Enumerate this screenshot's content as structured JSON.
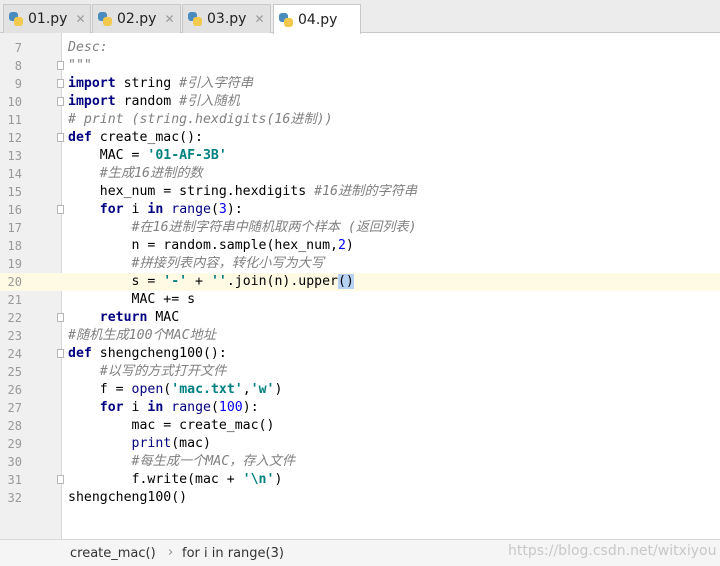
{
  "tabs": [
    {
      "label": "01.py",
      "active": false
    },
    {
      "label": "02.py",
      "active": false
    },
    {
      "label": "03.py",
      "active": false
    },
    {
      "label": "04.py",
      "active": true
    }
  ],
  "lines": [
    {
      "n": "7",
      "t": "Desc:"
    },
    {
      "n": "8",
      "t": "\"\"\""
    },
    {
      "n": "9",
      "t": "import string #引入字符串"
    },
    {
      "n": "10",
      "t": "import random #引入随机"
    },
    {
      "n": "11",
      "t": "# print (string.hexdigits(16进制))"
    },
    {
      "n": "12",
      "t": "def create_mac():"
    },
    {
      "n": "13",
      "t": "    MAC = '01-AF-3B'"
    },
    {
      "n": "14",
      "t": "    #生成16进制的数"
    },
    {
      "n": "15",
      "t": "    hex_num = string.hexdigits #16进制的字符串"
    },
    {
      "n": "16",
      "t": "    for i in range(3):"
    },
    {
      "n": "17",
      "t": "        #在16进制字符串中随机取两个样本 (返回列表)"
    },
    {
      "n": "18",
      "t": "        n = random.sample(hex_num,2)"
    },
    {
      "n": "19",
      "t": "        #拼接列表内容，转化小写为大写"
    },
    {
      "n": "20",
      "t": "        s = '-' + ''.join(n).upper()"
    },
    {
      "n": "21",
      "t": "        MAC += s"
    },
    {
      "n": "22",
      "t": "    return MAC"
    },
    {
      "n": "23",
      "t": "#随机生成100个MAC地址"
    },
    {
      "n": "24",
      "t": "def shengcheng100():"
    },
    {
      "n": "25",
      "t": "    #以写的方式打开文件"
    },
    {
      "n": "26",
      "t": "    f = open('mac.txt','w')"
    },
    {
      "n": "27",
      "t": "    for i in range(100):"
    },
    {
      "n": "28",
      "t": "        mac = create_mac()"
    },
    {
      "n": "29",
      "t": "        print(mac)"
    },
    {
      "n": "30",
      "t": "        #每生成一个MAC，存入文件"
    },
    {
      "n": "31",
      "t": "        f.write(mac + '\\n')"
    },
    {
      "n": "32",
      "t": "shengcheng100()"
    }
  ],
  "current_line": "20",
  "breadcrumb": {
    "function": "create_mac()",
    "block": "for i in range(3)",
    "separator": "›"
  },
  "watermark": "https://blog.csdn.net/witxiyou",
  "colors": {
    "keyword": "#000080",
    "string": "#008080",
    "comment": "#808080",
    "number": "#0000ff",
    "current_line": "#fffae3"
  }
}
